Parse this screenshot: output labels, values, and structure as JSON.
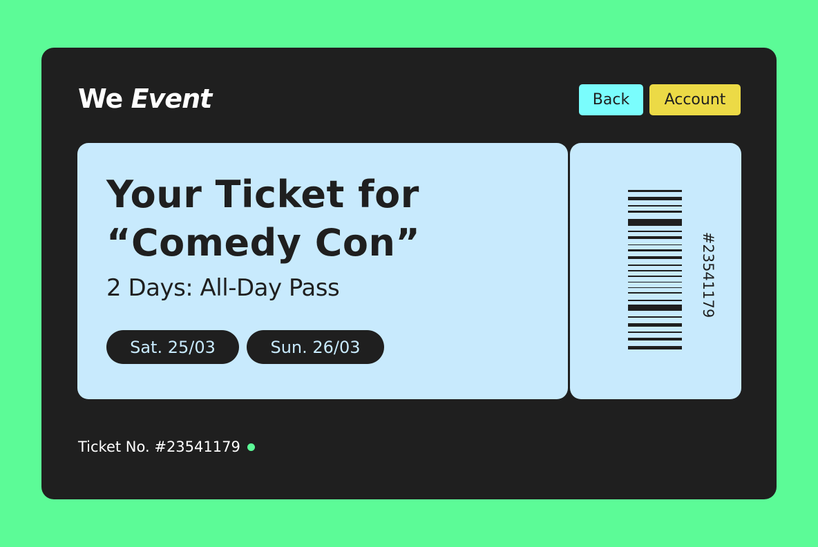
{
  "brand": {
    "word1": "We",
    "word2": "Event"
  },
  "nav": {
    "back_label": "Back",
    "account_label": "Account"
  },
  "ticket": {
    "title_line1": "Your Ticket for",
    "title_line2": "“Comedy Con”",
    "subtitle": "2 Days: All-Day Pass",
    "dates": [
      "Sat. 25/03",
      "Sun. 26/03"
    ],
    "stub_number": "#23541179"
  },
  "footer": {
    "ticket_no": "Ticket No. #23541179"
  },
  "colors": {
    "page_bg": "#5cfb97",
    "card_bg": "#1f1f1f",
    "ticket_bg": "#c8eafd",
    "back_button": "#7afdfd",
    "account_button": "#ecda46",
    "status_dot": "#5cfb97"
  }
}
